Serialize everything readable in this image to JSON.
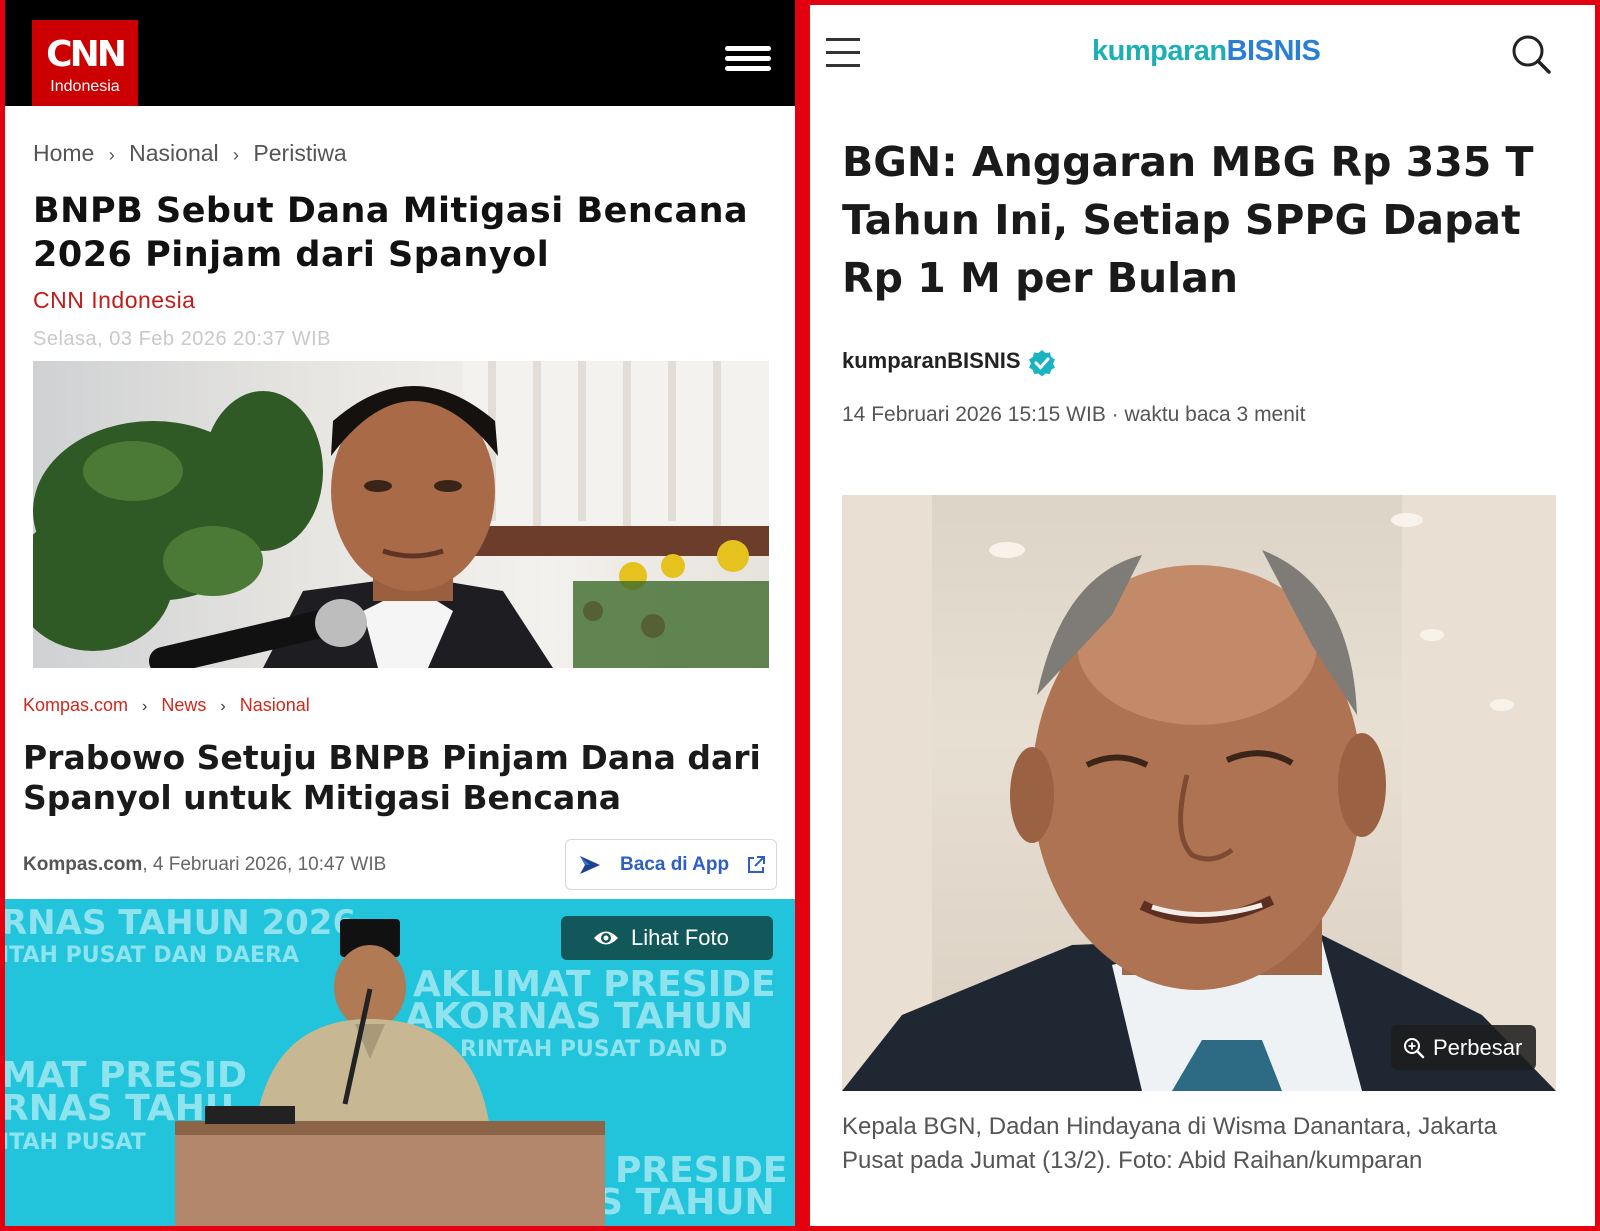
{
  "left": {
    "cnn": {
      "logo_big": "CNN",
      "logo_small": "Indonesia",
      "breadcrumb": [
        "Home",
        "Nasional",
        "Peristiwa"
      ],
      "breadcrumb_sep": "›",
      "title": "BNPB Sebut Dana Mitigasi Bencana 2026 Pinjam dari Spanyol",
      "source": "CNN Indonesia",
      "date": "Selasa, 03 Feb 2026 20:37 WIB"
    },
    "kompas": {
      "breadcrumb": [
        "Kompas.com",
        "News",
        "Nasional"
      ],
      "breadcrumb_sep": "›",
      "title": "Prabowo Setuju BNPB Pinjam Dana dari Spanyol untuk Mitigasi Bencana",
      "meta_source": "Kompas.com",
      "meta_date": ", 4 Februari 2026, 10:47 WIB",
      "app_button": "Baca di App",
      "photo_button": "Lihat Foto",
      "banner_text": [
        "RNAS TAHUN 2026",
        "ITAH PUSAT DAN DAERA",
        "AKLIMAT PRESIDE",
        "AKORNAS TAHUN",
        "RINTAH PUSAT DAN D",
        "MAT PRESID",
        "RNAS TAHU",
        "ITAH PUSAT",
        "PRESIDE",
        "S TAHUN"
      ]
    }
  },
  "right": {
    "logo_part1": "kumparan",
    "logo_part2": "BISNIS",
    "title": "BGN: Anggaran MBG Rp 335 T Tahun Ini, Setiap SPPG Dapat Rp 1 M per Bulan",
    "author": "kumparanBISNIS",
    "date": "14 Februari 2026 15:15 WIB · waktu baca 3 menit",
    "photo_button": "Perbesar",
    "caption": "Kepala BGN, Dadan Hindayana di Wisma Danantara, Jakarta Pusat pada Jumat (13/2). Foto: Abid Raihan/kumparan"
  },
  "icons": [
    "menu-icon",
    "hamburger-icon",
    "search-icon",
    "verified-icon",
    "eye-icon",
    "external-link-icon",
    "zoom-icon",
    "app-arrow-icon"
  ],
  "colors": {
    "divider": "#e3000f",
    "cnn_red": "#cc0000",
    "kompas_red": "#d0281c",
    "kumparan_teal": "#1cb0b4",
    "kumparan_blue": "#2a7fd4"
  }
}
